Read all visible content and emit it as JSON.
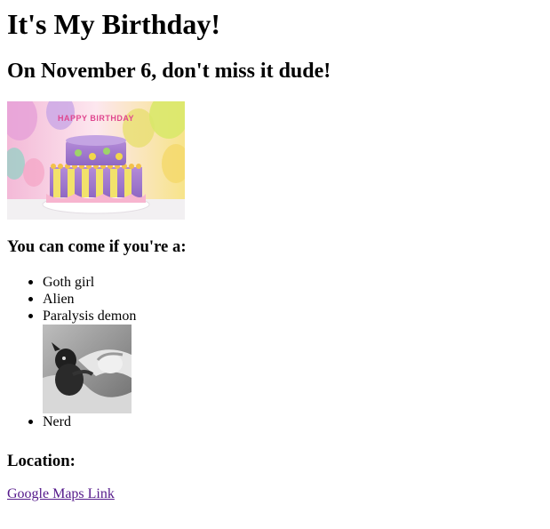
{
  "page": {
    "title": "It's My Birthday!",
    "subtitle": "On November 6, don't miss it dude!"
  },
  "invite": {
    "heading": "You can come if you're a:",
    "guests": [
      {
        "label": "Goth girl"
      },
      {
        "label": "Alien"
      },
      {
        "label": "Paralysis demon"
      },
      {
        "label": "Nerd"
      }
    ]
  },
  "location": {
    "heading": "Location:",
    "link_text": "Google Maps Link"
  },
  "images": {
    "cake": "birthday-cake-image",
    "cake_sign": "HAPPY BIRTHDAY",
    "demon": "paralysis-demon-image"
  },
  "colors": {
    "link_visited": "#551a8b",
    "text": "#000000",
    "background": "#ffffff"
  }
}
